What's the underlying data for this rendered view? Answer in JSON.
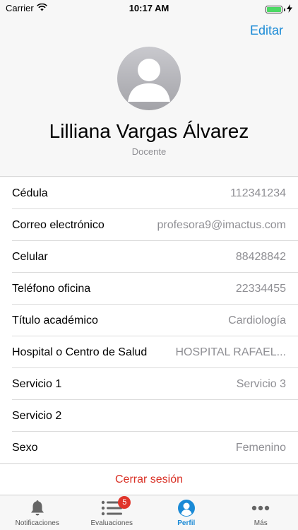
{
  "status_bar": {
    "carrier": "Carrier",
    "time": "10:17 AM",
    "battery_level": 1.0
  },
  "nav": {
    "edit_label": "Editar"
  },
  "profile": {
    "name": "Lilliana Vargas Álvarez",
    "role": "Docente",
    "avatar_icon": "person-placeholder-icon"
  },
  "details": [
    {
      "label": "Cédula",
      "value": "112341234"
    },
    {
      "label": "Correo electrónico",
      "value": "profesora9@imactus.com"
    },
    {
      "label": "Celular",
      "value": "88428842"
    },
    {
      "label": "Teléfono oficina",
      "value": "22334455"
    },
    {
      "label": "Título académico",
      "value": "Cardiología"
    },
    {
      "label": "Hospital o Centro de Salud",
      "value": "HOSPITAL RAFAEL..."
    },
    {
      "label": "Servicio 1",
      "value": "Servicio 3"
    },
    {
      "label": "Servicio 2",
      "value": ""
    },
    {
      "label": "Sexo",
      "value": "Femenino"
    }
  ],
  "logout_label": "Cerrar sesión",
  "tabs": [
    {
      "label": "Notificaciones",
      "icon": "bell-icon",
      "active": false
    },
    {
      "label": "Evaluaciones",
      "icon": "list-icon",
      "badge": "5",
      "active": false
    },
    {
      "label": "Perfil",
      "icon": "profile-icon",
      "active": true
    },
    {
      "label": "Más",
      "icon": "more-icon",
      "active": false
    }
  ],
  "colors": {
    "accent": "#1a8ad6",
    "destructive": "#d93025",
    "badge": "#e0352b",
    "secondary_text": "#8e8e93"
  }
}
